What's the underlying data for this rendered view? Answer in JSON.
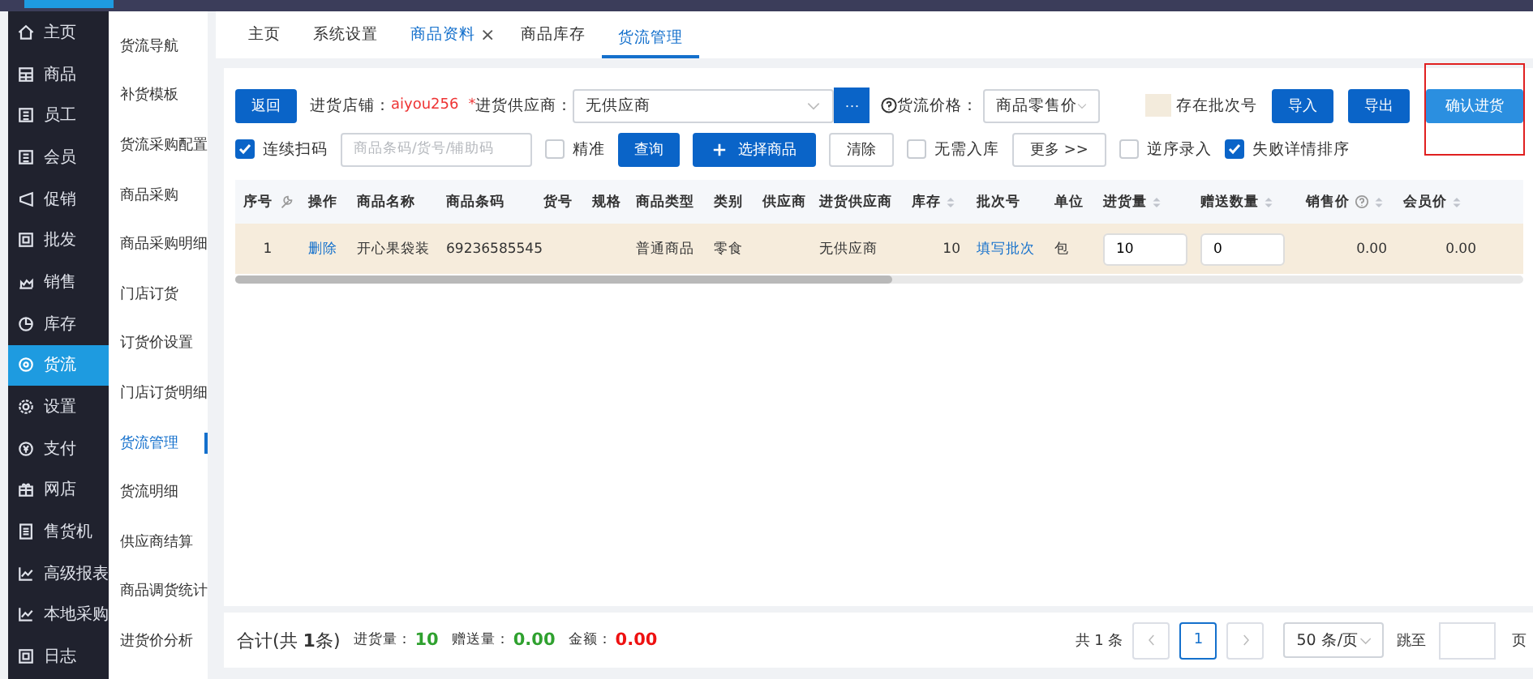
{
  "nav": [
    {
      "label": "主页",
      "selected": false
    },
    {
      "label": "商品",
      "selected": false
    },
    {
      "label": "员工",
      "selected": false
    },
    {
      "label": "会员",
      "selected": false
    },
    {
      "label": "促销",
      "selected": false
    },
    {
      "label": "批发",
      "selected": false
    },
    {
      "label": "销售",
      "selected": false
    },
    {
      "label": "库存",
      "selected": false
    },
    {
      "label": "货流",
      "selected": true
    },
    {
      "label": "设置",
      "selected": false
    },
    {
      "label": "支付",
      "selected": false
    },
    {
      "label": "网店",
      "selected": false
    },
    {
      "label": "售货机",
      "selected": false
    },
    {
      "label": "高级报表",
      "selected": false
    },
    {
      "label": "本地采购",
      "selected": false
    },
    {
      "label": "日志",
      "selected": false
    }
  ],
  "submenu": [
    {
      "label": "货流导航",
      "selected": false
    },
    {
      "label": "补货模板",
      "selected": false
    },
    {
      "label": "货流采购配置",
      "selected": false
    },
    {
      "label": "商品采购",
      "selected": false
    },
    {
      "label": "商品采购明细",
      "selected": false
    },
    {
      "label": "门店订货",
      "selected": false
    },
    {
      "label": "订货价设置",
      "selected": false
    },
    {
      "label": "门店订货明细",
      "selected": false
    },
    {
      "label": "货流管理",
      "selected": true
    },
    {
      "label": "货流明细",
      "selected": false
    },
    {
      "label": "供应商结算",
      "selected": false
    },
    {
      "label": "商品调货统计",
      "selected": false
    },
    {
      "label": "进货价分析",
      "selected": false
    }
  ],
  "tabs": [
    {
      "label": "主页",
      "selected": false,
      "hovered": false
    },
    {
      "label": "系统设置",
      "selected": false,
      "hovered": false
    },
    {
      "label": "商品资料",
      "selected": false,
      "hovered": true,
      "close": "×"
    },
    {
      "label": "商品库存",
      "selected": false,
      "hovered": false
    },
    {
      "label": "货流管理",
      "selected": true,
      "hovered": false
    }
  ],
  "toolbar": {
    "back": "返回",
    "store_label": "进货店铺：",
    "store": "aiyou256",
    "required_mark": "*",
    "supplier_label": "进货供应商：",
    "supplier": "无供应商",
    "supplier_more": "···",
    "price_label": "货流价格：",
    "price": "商品零售价",
    "legend": "存在批次号",
    "actions": [
      "导入",
      "导出",
      "确认进货"
    ]
  },
  "filters": [
    {
      "kind": "checkbox",
      "label": "连续扫码",
      "checked": true
    },
    {
      "kind": "search",
      "placeholder": "商品条码/货号/辅助码"
    },
    {
      "kind": "checkbox",
      "label": "精准",
      "checked": false
    },
    {
      "kind": "primary",
      "label": "查询"
    },
    {
      "kind": "add",
      "label": "选择商品"
    },
    {
      "kind": "plain",
      "label": "清除"
    },
    {
      "kind": "checkbox",
      "label": "无需入库",
      "checked": false
    },
    {
      "kind": "plain",
      "label": "更多 >>"
    },
    {
      "kind": "checkbox",
      "label": "逆序录入",
      "checked": false
    },
    {
      "kind": "checkbox",
      "label": "失败详情排序",
      "checked": true
    }
  ],
  "table": {
    "columns": [
      {
        "label": "序号",
        "sortable": false,
        "help": false
      },
      {
        "label": "操作",
        "sortable": false,
        "help": false
      },
      {
        "label": "商品名称",
        "sortable": false,
        "help": false
      },
      {
        "label": "商品条码",
        "sortable": false,
        "help": false
      },
      {
        "label": "货号",
        "sortable": false,
        "help": false
      },
      {
        "label": "规格",
        "sortable": false,
        "help": false
      },
      {
        "label": "商品类型",
        "sortable": false,
        "help": false
      },
      {
        "label": "类别",
        "sortable": false,
        "help": false
      },
      {
        "label": "供应商",
        "sortable": false,
        "help": false
      },
      {
        "label": "进货供应商",
        "sortable": false,
        "help": false
      },
      {
        "label": "库存",
        "sortable": true,
        "help": false
      },
      {
        "label": "批次号",
        "sortable": false,
        "help": false
      },
      {
        "label": "单位",
        "sortable": false,
        "help": false
      },
      {
        "label": "进货量",
        "sortable": true,
        "help": false
      },
      {
        "label": "赠送数量",
        "sortable": true,
        "help": false
      },
      {
        "label": "销售价",
        "sortable": true,
        "help": true
      },
      {
        "label": "会员价",
        "sortable": true,
        "help": false
      }
    ],
    "rows": [
      {
        "batch": true,
        "cells": [
          {
            "kind": "num",
            "text": "1"
          },
          {
            "kind": "link",
            "text": "删除"
          },
          {
            "kind": "text",
            "text": "开心果袋装"
          },
          {
            "kind": "text",
            "text": "69236585545"
          },
          {
            "kind": "empty"
          },
          {
            "kind": "empty"
          },
          {
            "kind": "text",
            "text": "普通商品"
          },
          {
            "kind": "text",
            "text": "零食"
          },
          {
            "kind": "empty"
          },
          {
            "kind": "text",
            "text": "无供应商"
          },
          {
            "kind": "num",
            "text": "10"
          },
          {
            "kind": "link",
            "text": "填写批次"
          },
          {
            "kind": "text",
            "text": "包"
          },
          {
            "kind": "input",
            "text": "10"
          },
          {
            "kind": "input",
            "text": "0"
          },
          {
            "kind": "num",
            "text": "0.00"
          },
          {
            "kind": "num",
            "text": "0.00"
          }
        ]
      }
    ]
  },
  "footer": {
    "summary": "合计(共 **1**条)",
    "stats": [
      {
        "label": "进货量：",
        "value": "10",
        "color": "#2fa12f"
      },
      {
        "label": "赠送量：",
        "value": "0.00",
        "color": "#2fa12f"
      },
      {
        "label": "金额：",
        "value": "0.00",
        "color": "#ee1111"
      }
    ],
    "total": "共 1 条",
    "pages": [
      {
        "label": "1",
        "selected": true
      }
    ],
    "page_size": "50 条/页",
    "jump_label": "跳至",
    "page_unit": "页"
  }
}
